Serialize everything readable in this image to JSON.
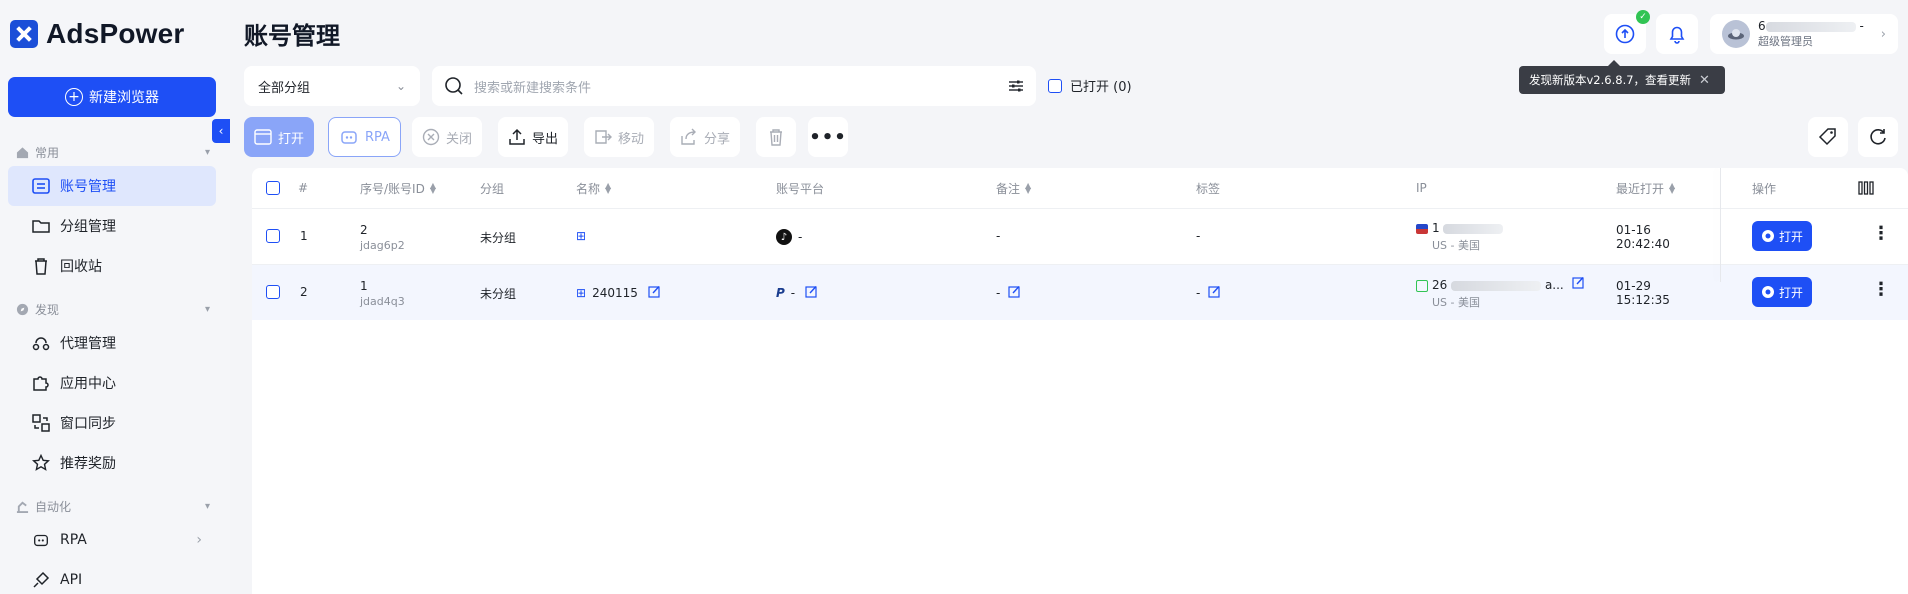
{
  "brand": {
    "name": "AdsPower",
    "accent": "#1e4ff5"
  },
  "sidebar": {
    "new_browser_label": "新建浏览器",
    "sections": [
      {
        "label": "常用",
        "items": [
          {
            "label": "账号管理",
            "active": true,
            "icon": "list-icon"
          },
          {
            "label": "分组管理",
            "icon": "folder-icon"
          },
          {
            "label": "回收站",
            "icon": "trash-icon"
          }
        ]
      },
      {
        "label": "发现",
        "items": [
          {
            "label": "代理管理",
            "icon": "proxy-icon"
          },
          {
            "label": "应用中心",
            "icon": "puzzle-icon"
          },
          {
            "label": "窗口同步",
            "icon": "sync-icon"
          },
          {
            "label": "推荐奖励",
            "icon": "star-icon"
          }
        ]
      },
      {
        "label": "自动化",
        "items": [
          {
            "label": "RPA",
            "icon": "robot-icon"
          },
          {
            "label": "API",
            "icon": "plug-icon"
          }
        ]
      }
    ]
  },
  "header": {
    "title": "账号管理",
    "user_name": "6",
    "user_name_suffix": "-",
    "user_role": "超级管理员",
    "update_tooltip": "发现新版本v2.6.8.7，查看更新"
  },
  "filters": {
    "group_value": "全部分组",
    "search_placeholder": "搜索或新建搜索条件",
    "opened_label": "已打开 (0)"
  },
  "toolbar": {
    "open": "打开",
    "rpa": "RPA",
    "close": "关闭",
    "export": "导出",
    "move": "移动",
    "share": "分享"
  },
  "table": {
    "headers": {
      "index": "#",
      "seq_id": "序号/账号ID",
      "group": "分组",
      "name": "名称",
      "platform": "账号平台",
      "remark": "备注",
      "tag": "标签",
      "ip": "IP",
      "last_open": "最近打开",
      "actions": "操作"
    },
    "rows": [
      {
        "index": "1",
        "seq": "2",
        "acc_id": "jdag6p2",
        "group": "未分组",
        "name": "",
        "platform_icon": "tiktok-icon",
        "platform": "-",
        "remark": "-",
        "tag": "-",
        "ip_prefix": "1",
        "ip_suffix": "",
        "ip_loc": "US - 美国",
        "last_date": "01-16",
        "last_time": "20:42:40",
        "open_label": "打开"
      },
      {
        "index": "2",
        "seq": "1",
        "acc_id": "jdad4q3",
        "group": "未分组",
        "name": "240115",
        "platform_icon": "paypal-icon",
        "platform": "-",
        "remark": "-",
        "tag": "-",
        "ip_prefix": "26",
        "ip_suffix": "a...",
        "ip_loc": "US - 美国",
        "last_date": "01-29",
        "last_time": "15:12:35",
        "open_label": "打开"
      }
    ]
  }
}
